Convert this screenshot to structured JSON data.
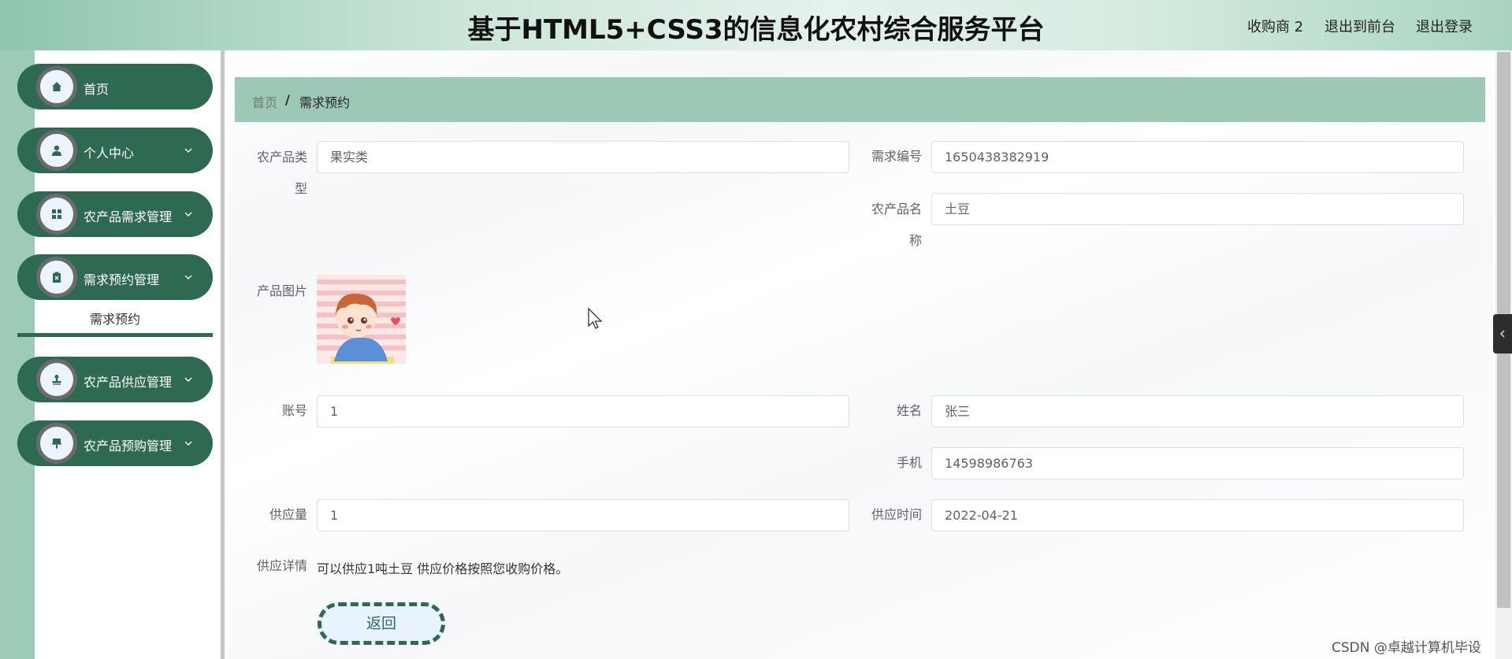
{
  "header": {
    "title": "基于HTML5+CSS3的信息化农村综合服务平台",
    "user": "收购商 2",
    "to_front": "退出到前台",
    "logout": "退出登录"
  },
  "sidebar": {
    "items": [
      {
        "label": "首页",
        "icon": "home-icon"
      },
      {
        "label": "个人中心",
        "icon": "user-icon"
      },
      {
        "label": "农产品需求管理",
        "icon": "grid-icon"
      },
      {
        "label": "需求预约管理",
        "icon": "clipboard-icon"
      },
      {
        "label": "农产品供应管理",
        "icon": "stamp-icon"
      },
      {
        "label": "农产品预购管理",
        "icon": "pin-icon"
      }
    ],
    "submenu": {
      "label": "需求预约"
    }
  },
  "breadcrumb": {
    "home": "首页",
    "separator": "/",
    "current": "需求预约"
  },
  "form": {
    "category_label": "农产品类型",
    "category_value": "果实类",
    "demand_no_label": "需求编号",
    "demand_no_value": "1650438382919",
    "product_name_label": "农产品名称",
    "product_name_value": "土豆",
    "image_label": "产品图片",
    "account_label": "账号",
    "account_value": "1",
    "name_label": "姓名",
    "name_value": "张三",
    "phone_label": "手机",
    "phone_value": "14598986763",
    "supply_qty_label": "供应量",
    "supply_qty_value": "1",
    "supply_time_label": "供应时间",
    "supply_time_value": "2022-04-21",
    "supply_detail_label": "供应详情",
    "supply_detail_value": "可以供应1吨土豆  供应价格按照您收购价格。"
  },
  "buttons": {
    "back": "返回"
  },
  "watermark": "CSDN @卓越计算机毕设",
  "colors": {
    "primary": "#2e6a52",
    "breadcrumb_bg": "#9dc8b5",
    "left_strip": "#9dcbb7"
  }
}
